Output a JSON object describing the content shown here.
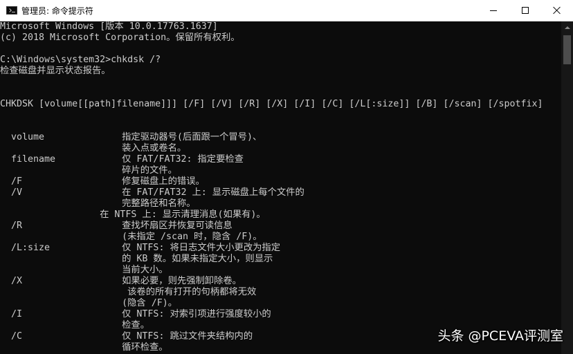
{
  "window": {
    "title": "管理员: 命令提示符",
    "icon": "cmd-icon",
    "controls": {
      "minimize_icon": "minimize-icon",
      "maximize_icon": "maximize-icon",
      "close_icon": "close-icon"
    }
  },
  "console": {
    "lines": [
      "Microsoft Windows [版本 10.0.17763.1637]",
      "(c) 2018 Microsoft Corporation。保留所有权利。",
      "",
      "C:\\Windows\\system32>chkdsk /?",
      "检查磁盘并显示状态报告。",
      "",
      "",
      "CHKDSK [volume[[path]filename]]] [/F] [/V] [/R] [/X] [/I] [/C] [/L[:size]] [/B] [/scan] [/spotfix]",
      "",
      "",
      "  volume              指定驱动器号(后面跟一个冒号)、",
      "                      装入点或卷名。",
      "  filename            仅 FAT/FAT32: 指定要检查",
      "                      碎片的文件。",
      "  /F                  修复磁盘上的错误。",
      "  /V                  在 FAT/FAT32 上: 显示磁盘上每个文件的",
      "                      完整路径和名称。",
      "                  在 NTFS 上: 显示清理消息(如果有)。",
      "  /R                  查找坏扇区并恢复可读信息",
      "                      (未指定 /scan 时，隐含 /F)。",
      "  /L:size             仅 NTFS: 将日志文件大小更改为指定",
      "                      的 KB 数。如果未指定大小，则显示",
      "                      当前大小。",
      "  /X                  如果必要，则先强制卸除卷。",
      "                       该卷的所有打开的句柄都将无效",
      "                      (隐含 /F)。",
      "  /I                  仅 NTFS: 对索引项进行强度较小的",
      "                      检查。",
      "  /C                  仅 NTFS: 跳过文件夹结构内的",
      "                      循环检查。"
    ]
  },
  "watermark": {
    "text": "头条 @PCEVA评测室"
  },
  "colors": {
    "console_bg": "#0c0c0c",
    "console_fg": "#cccccc",
    "titlebar_bg": "#ffffff"
  }
}
